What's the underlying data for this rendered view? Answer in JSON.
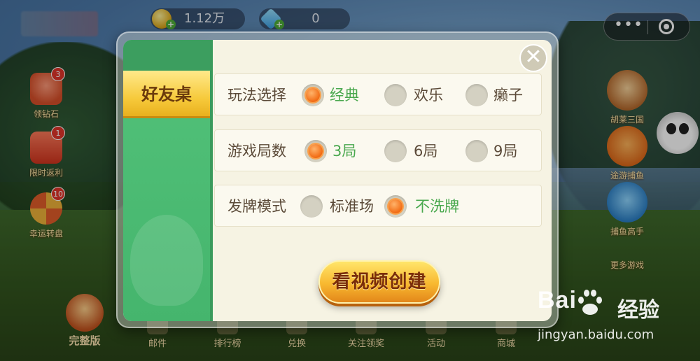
{
  "topbar": {
    "coins": "1.12万",
    "gems": "0"
  },
  "left_side": [
    {
      "label": "领钻石",
      "badge": "3"
    },
    {
      "label": "限时返利",
      "badge": "1"
    },
    {
      "label": "幸运转盘",
      "badge": "10"
    }
  ],
  "right_side": [
    {
      "label": "胡莱三国"
    },
    {
      "label": "途游捕鱼"
    },
    {
      "label": "捕鱼高手"
    },
    {
      "label": "更多游戏"
    }
  ],
  "bottom_bar": {
    "full_version": "完整版",
    "items": [
      "邮件",
      "排行榜",
      "兑换",
      "关注领奖",
      "活动",
      "商城"
    ]
  },
  "dialog": {
    "tab_label": "好友桌",
    "rows": [
      {
        "label": "玩法选择",
        "options": [
          "经典",
          "欢乐",
          "癞子"
        ],
        "selected": 0
      },
      {
        "label": "游戏局数",
        "options": [
          "3局",
          "6局",
          "9局"
        ],
        "selected": 0
      },
      {
        "label": "发牌模式",
        "options": [
          "标准场",
          "不洗牌"
        ],
        "selected": 1
      }
    ],
    "create_button": "看视频创建",
    "close_symbol": "✕"
  },
  "watermark": {
    "logo": "Bai",
    "logo_suffix": "经验",
    "url": "jingyan.baidu.com"
  },
  "capsule": {
    "more_symbol": "•••"
  }
}
